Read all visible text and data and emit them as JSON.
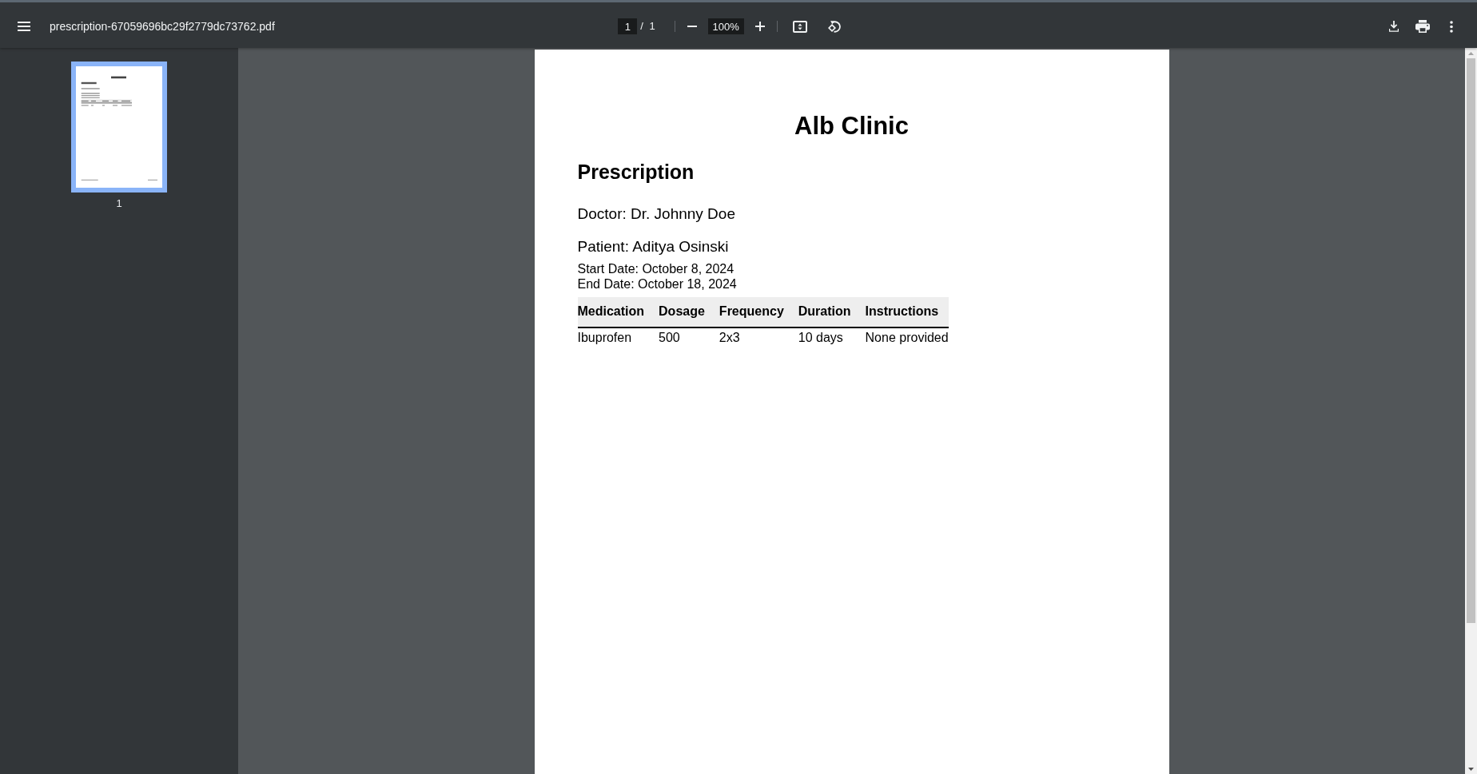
{
  "toolbar": {
    "file_name": "prescription-67059696bc29f2779dc73762.pdf",
    "page_number": "1",
    "page_total": "/ 1",
    "zoom": "100%"
  },
  "sidebar": {
    "thumbnails": [
      {
        "label": "1",
        "selected": true
      }
    ]
  },
  "document": {
    "clinic": "Alb Clinic",
    "heading": "Prescription",
    "doctor": "Doctor: Dr. Johnny Doe",
    "patient": "Patient: Aditya Osinski",
    "dates": [
      "Start Date: October 8, 2024",
      "End Date: October 18, 2024"
    ],
    "table": {
      "columns": [
        "Medication",
        "Dosage",
        "Frequency",
        "Duration",
        "Instructions"
      ],
      "rows": [
        [
          "Ibuprofen",
          "500",
          "2x3",
          "10 days",
          "None provided"
        ]
      ]
    }
  }
}
